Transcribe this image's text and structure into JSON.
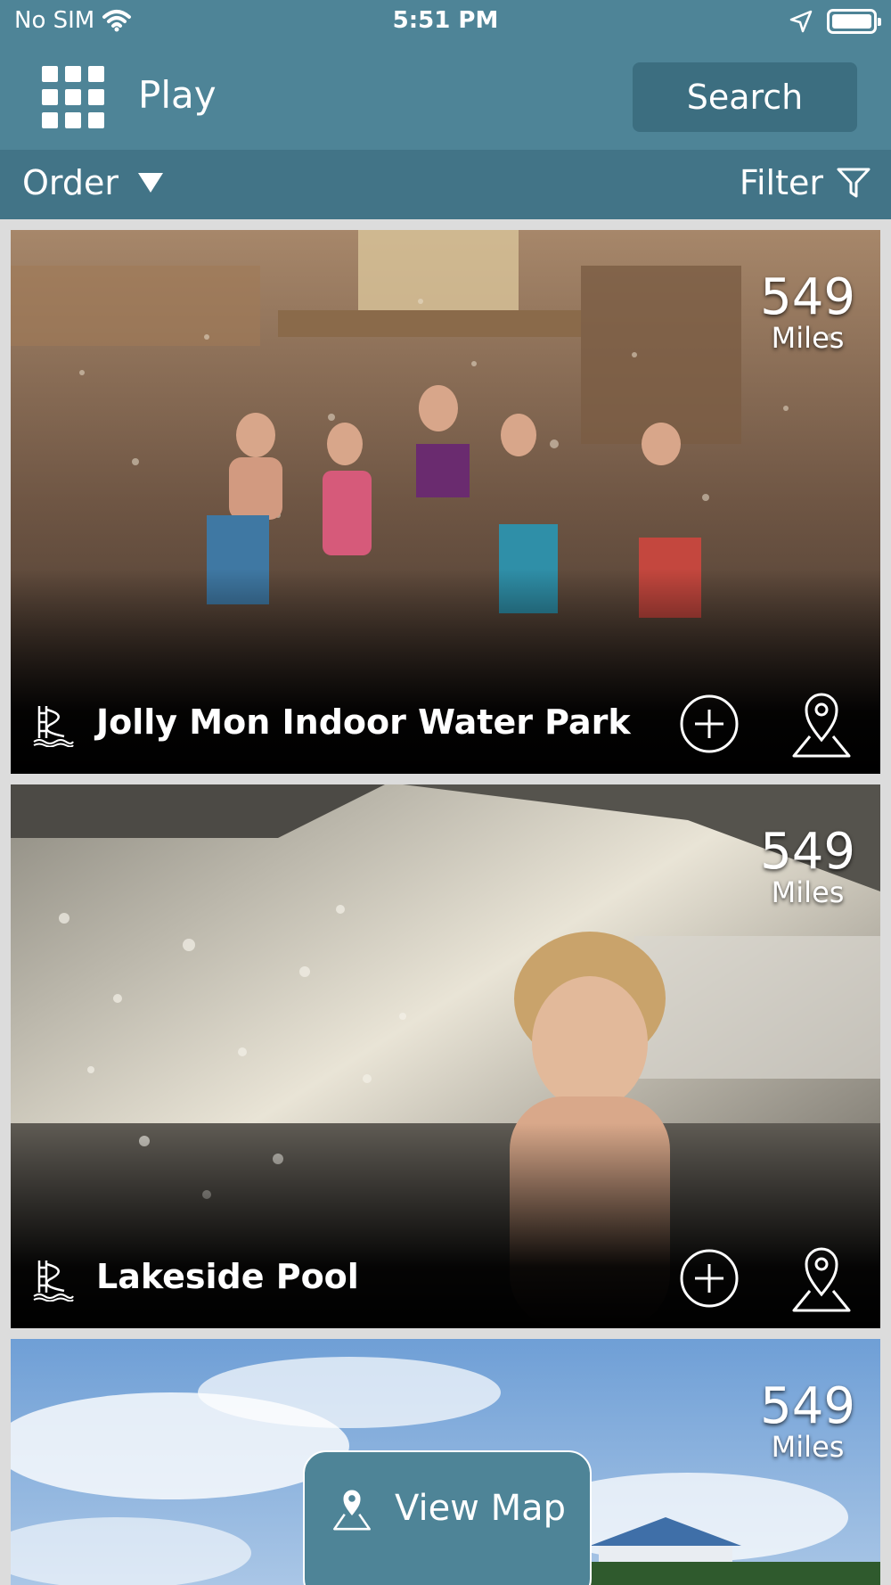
{
  "status_bar": {
    "carrier": "No SIM",
    "time": "5:51 PM",
    "icons": [
      "wifi-icon",
      "location-arrow-icon",
      "battery-icon"
    ]
  },
  "nav": {
    "title": "Play",
    "search_label": "Search",
    "menu_icon": "grid-menu-icon"
  },
  "toolbar": {
    "order_label": "Order",
    "filter_label": "Filter"
  },
  "cards": [
    {
      "title": "Jolly Mon Indoor Water Park",
      "distance": "549",
      "distance_unit": "Miles",
      "type_icon": "waterslide-icon"
    },
    {
      "title": "Lakeside Pool",
      "distance": "549",
      "distance_unit": "Miles",
      "type_icon": "waterslide-icon"
    },
    {
      "title": "",
      "distance": "549",
      "distance_unit": "Miles",
      "type_icon": ""
    }
  ],
  "view_map": {
    "label": "View Map"
  },
  "colors": {
    "header": "#4e8497",
    "toolbar": "#427487",
    "search_button": "#3c6e80"
  }
}
